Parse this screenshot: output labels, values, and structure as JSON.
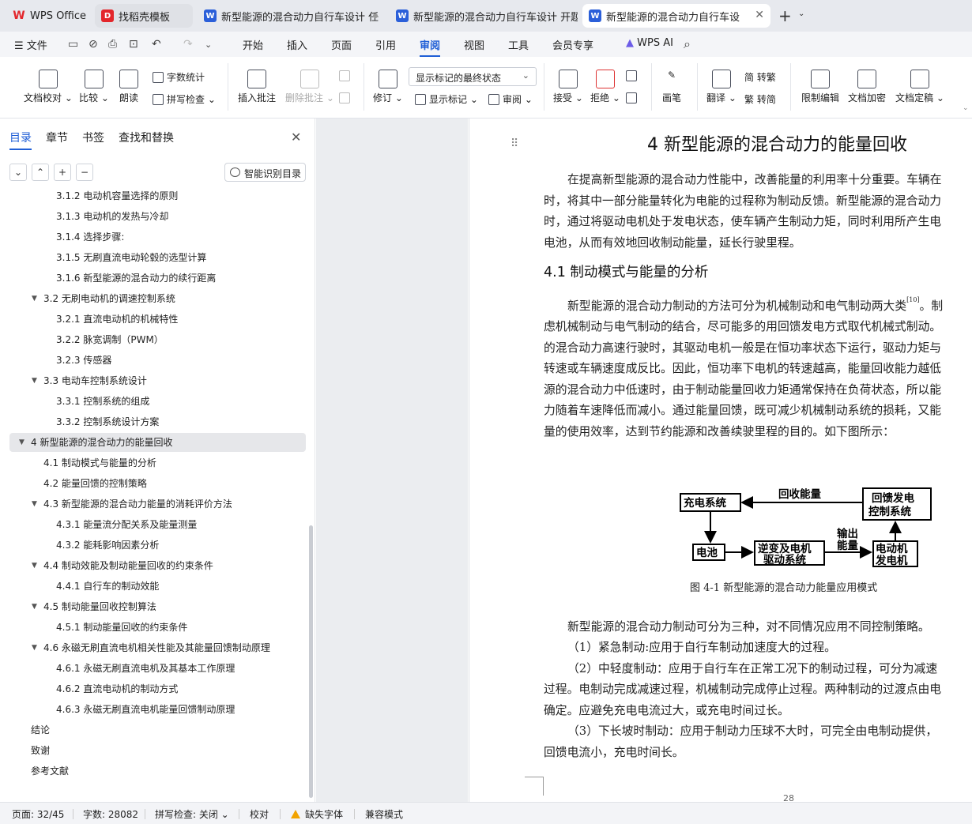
{
  "tabs": [
    {
      "label": "WPS Office",
      "icon": "wps-logo-icon",
      "color": "#e3262b"
    },
    {
      "label": "找稻壳模板",
      "icon": "docer-icon",
      "color": "#e3262b"
    },
    {
      "label": "新型能源的混合动力自行车设计 任",
      "icon": "writer-icon",
      "color": "#2b5fd9"
    },
    {
      "label": "新型能源的混合动力自行车设计 开题",
      "icon": "writer-icon",
      "color": "#2b5fd9"
    },
    {
      "label": "新型能源的混合动力自行车设",
      "icon": "writer-icon",
      "color": "#2b5fd9"
    }
  ],
  "menu": {
    "file": "文件",
    "items": [
      "开始",
      "插入",
      "页面",
      "引用",
      "审阅",
      "视图",
      "工具",
      "会员专享"
    ],
    "active": "审阅",
    "ai": "WPS AI"
  },
  "ribbon": {
    "proof": "文档校对",
    "compare": "比较",
    "read": "朗读",
    "wordcount": "字数统计",
    "spell": "拼写检查",
    "insert_comment": "插入批注",
    "delete_comment": "删除批注",
    "revise": "修订",
    "markup_state": "显示标记的最终状态",
    "show_markup": "显示标记",
    "review": "审阅",
    "accept": "接受",
    "reject": "拒绝",
    "pen": "画笔",
    "translate": "翻译",
    "to_trad": "简 转繁",
    "to_simp": "繁 转简",
    "restrict": "限制编辑",
    "encrypt": "文档加密",
    "finalize": "文档定稿"
  },
  "panel": {
    "tabs": [
      "目录",
      "章节",
      "书签",
      "查找和替换"
    ],
    "smart_toc": "智能识别目录",
    "toc": [
      {
        "text": "3.1.2  电动机容量选择的原则",
        "level": 3
      },
      {
        "text": "3.1.3  电动机的发热与冷却",
        "level": 3
      },
      {
        "text": "3.1.4  选择步骤:",
        "level": 3
      },
      {
        "text": "3.1.5  无刷直流电动轮毂的选型计算",
        "level": 3
      },
      {
        "text": "3.1.6  新型能源的混合动力的续行距离",
        "level": 3
      },
      {
        "text": "3.2  无刷电动机的调速控制系统",
        "level": 2,
        "arrow": true
      },
      {
        "text": "3.2.1  直流电动机的机械特性",
        "level": 3
      },
      {
        "text": "3.2.2  脉宽调制（PWM）",
        "level": 3
      },
      {
        "text": "3.2.3  传感器",
        "level": 3
      },
      {
        "text": "3.3  电动车控制系统设计",
        "level": 2,
        "arrow": true
      },
      {
        "text": "3.3.1  控制系统的组成",
        "level": 3
      },
      {
        "text": "3.3.2  控制系统设计方案",
        "level": 3
      },
      {
        "text": "4  新型能源的混合动力的能量回收",
        "level": 1,
        "arrow": true,
        "selected": true
      },
      {
        "text": "4.1  制动模式与能量的分析",
        "level": 2
      },
      {
        "text": "4.2  能量回馈的控制策略",
        "level": 2
      },
      {
        "text": "4.3  新型能源的混合动力能量的消耗评价方法",
        "level": 2,
        "arrow": true
      },
      {
        "text": "4.3.1  能量流分配关系及能量测量",
        "level": 3
      },
      {
        "text": "4.3.2  能耗影响因素分析",
        "level": 3
      },
      {
        "text": "4.4  制动效能及制动能量回收的约束条件",
        "level": 2,
        "arrow": true
      },
      {
        "text": "4.4.1  自行车的制动效能",
        "level": 3
      },
      {
        "text": "4.5  制动能量回收控制算法",
        "level": 2,
        "arrow": true
      },
      {
        "text": "4.5.1  制动能量回收的约束条件",
        "level": 3
      },
      {
        "text": "4.6  永磁无刷直流电机相关性能及其能量回馈制动原理",
        "level": 2,
        "arrow": true
      },
      {
        "text": "4.6.1  永磁无刷直流电机及其基本工作原理",
        "level": 3
      },
      {
        "text": "4.6.2  直流电动机的制动方式",
        "level": 3
      },
      {
        "text": "4.6.3  永磁无刷直流电机能量回馈制动原理",
        "level": 3
      },
      {
        "text": "结论",
        "level": 1
      },
      {
        "text": "致谢",
        "level": 1
      },
      {
        "text": "参考文献",
        "level": 1
      }
    ]
  },
  "doc": {
    "h1": "4  新型能源的混合动力的能量回收",
    "p1": [
      "在提高新型能源的混合动力性能中，改善能量的利用率十分重要。车辆在",
      "时，将其中一部分能量转化为电能的过程称为制动反馈。新型能源的混合动力",
      "时，通过将驱动电机处于发电状态，使车辆产生制动力矩，同时利用所产生电",
      "电池，从而有效地回收制动能量，延长行驶里程。"
    ],
    "h2": "4.1  制动模式与能量的分析",
    "p2_first": "新型能源的混合动力制动的方法可分为机械制动和电气制动两大类",
    "p2_ref": "[10]",
    "p2_first_tail": "。制",
    "p2": [
      "虑机械制动与电气制动的结合，尽可能多的用回馈发电方式取代机械式制动。",
      "的混合动力高速行驶时，其驱动电机一般是在恒功率状态下运行，驱动力矩与",
      "转速或车辆速度成反比。因此，恒功率下电机的转速越高，能量回收能力越低",
      "源的混合动力中低速时，由于制动能量回收力矩通常保持在负荷状态，所以能",
      "力随着车速降低而减小。通过能量回馈，既可减少机械制动系统的损耗，又能",
      "量的使用效率，达到节约能源和改善续驶里程的目的。如下图所示："
    ],
    "diagram": {
      "charge": "充电系统",
      "feedback_l1": "回馈发电",
      "feedback_l2": "控制系统",
      "recover": "回收能量",
      "battery": "电池",
      "inverter_l1": "逆变及电机",
      "inverter_l2": "驱动系统",
      "output_l1": "输出",
      "output_l2": "能量",
      "motor_l1": "电动机",
      "motor_l2": "发电机"
    },
    "caption": "图 4-1  新型能源的混合动力能量应用模式",
    "p3": [
      "新型能源的混合动力制动可分为三种，对不同情况应用不同控制策略。",
      "（1）紧急制动:应用于自行车制动加速度大的过程。",
      "（2）中轻度制动：应用于自行车在正常工况下的制动过程，可分为减速",
      "过程。电制动完成减速过程，机械制动完成停止过程。两种制动的过渡点由电",
      "确定。应避免充电电流过大，或充电时间过长。",
      "（3）下长坡时制动：应用于制动力压球不大时，可完全由电制动提供，",
      "回馈电流小，充电时间长。"
    ],
    "page_number": "28"
  },
  "status": {
    "page": "页面: 32/45",
    "words": "字数: 28082",
    "spell": "拼写检查: 关闭",
    "proof": "校对",
    "missing_font": "缺失字体",
    "compat": "兼容模式"
  }
}
